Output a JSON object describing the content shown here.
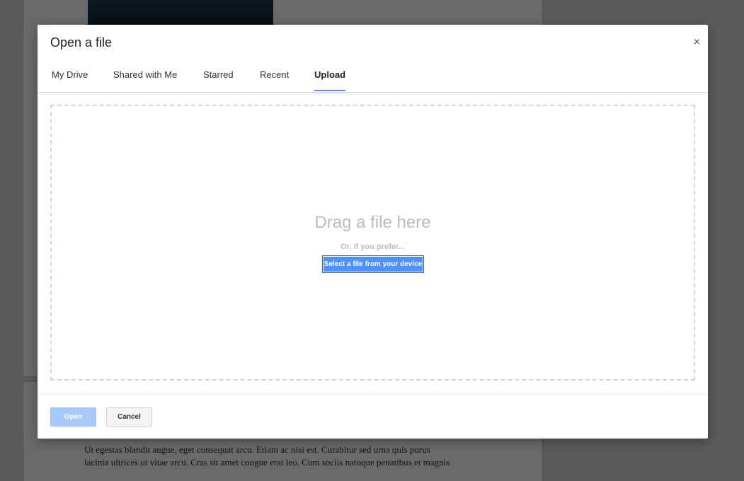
{
  "background_document": {
    "text_line_1": "Ut egestas blandit augue, eget consequat arcu. Etiam ac nisi est. Curabitur sed urna quis purus",
    "text_line_2": "lacinia ultrices ut vitae arcu. Cras sit amet congue erat leo. Cum sociis natoque penatibus et magnis"
  },
  "dialog": {
    "title": "Open a file",
    "close_icon": "close-icon",
    "close_glyph": "×",
    "tabs": [
      {
        "label": "My Drive",
        "active": false
      },
      {
        "label": "Shared with Me",
        "active": false
      },
      {
        "label": "Starred",
        "active": false
      },
      {
        "label": "Recent",
        "active": false
      },
      {
        "label": "Upload",
        "active": true
      }
    ],
    "upload": {
      "drag_text": "Drag a file here",
      "prefer_text": "Or, if you prefer...",
      "select_button": "Select a file from your device"
    },
    "footer": {
      "open_label": "Open",
      "cancel_label": "Cancel"
    }
  },
  "colors": {
    "accent": "#4d90fe",
    "open_disabled": "#a6c8fb",
    "overlay": "#5b5b5b"
  }
}
